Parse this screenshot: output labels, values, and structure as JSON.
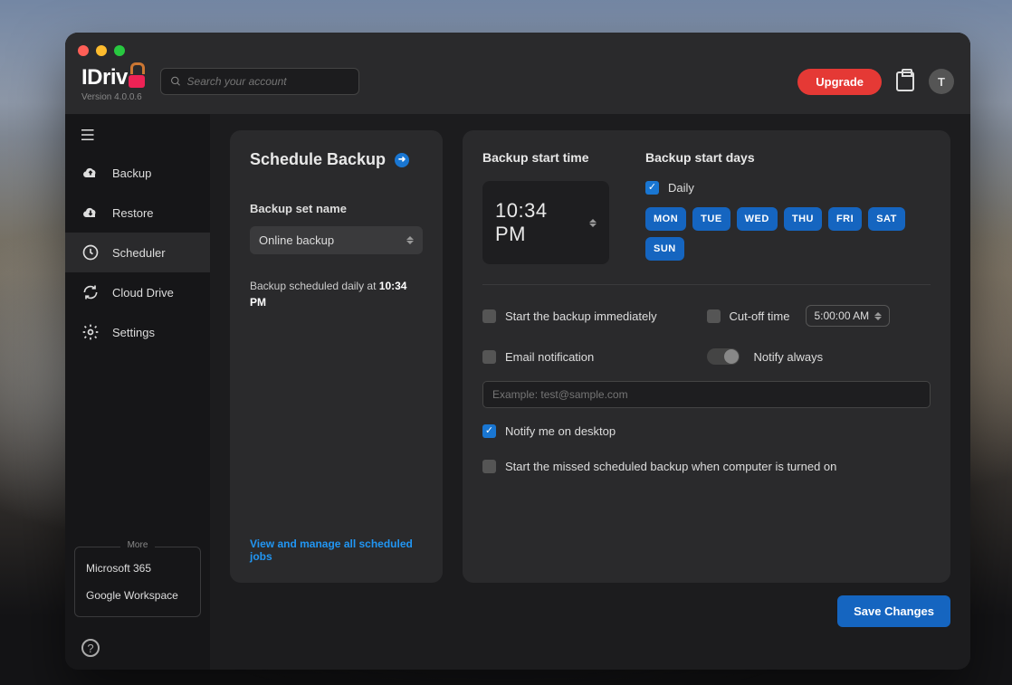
{
  "app": {
    "name_part1": "IDriv",
    "name_part2": "e",
    "version": "Version 4.0.0.6"
  },
  "search": {
    "placeholder": "Search your account"
  },
  "header": {
    "upgrade": "Upgrade",
    "avatar_initial": "T"
  },
  "sidebar": {
    "items": [
      {
        "label": "Backup"
      },
      {
        "label": "Restore"
      },
      {
        "label": "Scheduler"
      },
      {
        "label": "Cloud Drive"
      },
      {
        "label": "Settings"
      }
    ],
    "more_label": "More",
    "more_items": [
      {
        "label": "Microsoft 365"
      },
      {
        "label": "Google Workspace"
      }
    ]
  },
  "left_panel": {
    "title": "Schedule Backup",
    "set_name_label": "Backup set name",
    "set_name_value": "Online backup",
    "scheduled_text_pre": "Backup scheduled daily at ",
    "scheduled_time": "10:34 PM",
    "link": "View and manage all scheduled jobs"
  },
  "right_panel": {
    "start_time_label": "Backup start time",
    "start_time_value": "10:34 PM",
    "start_days_label": "Backup start days",
    "daily_label": "Daily",
    "days": [
      "MON",
      "TUE",
      "WED",
      "THU",
      "FRI",
      "SAT",
      "SUN"
    ],
    "opts": {
      "start_immediately": "Start the backup immediately",
      "cutoff": "Cut-off time",
      "cutoff_value": "5:00:00 AM",
      "email_notification": "Email notification",
      "notify_always": "Notify always",
      "email_placeholder": "Example: test@sample.com",
      "notify_desktop": "Notify me on desktop",
      "start_missed": "Start the missed scheduled backup when computer is turned on"
    }
  },
  "footer": {
    "save": "Save Changes"
  }
}
